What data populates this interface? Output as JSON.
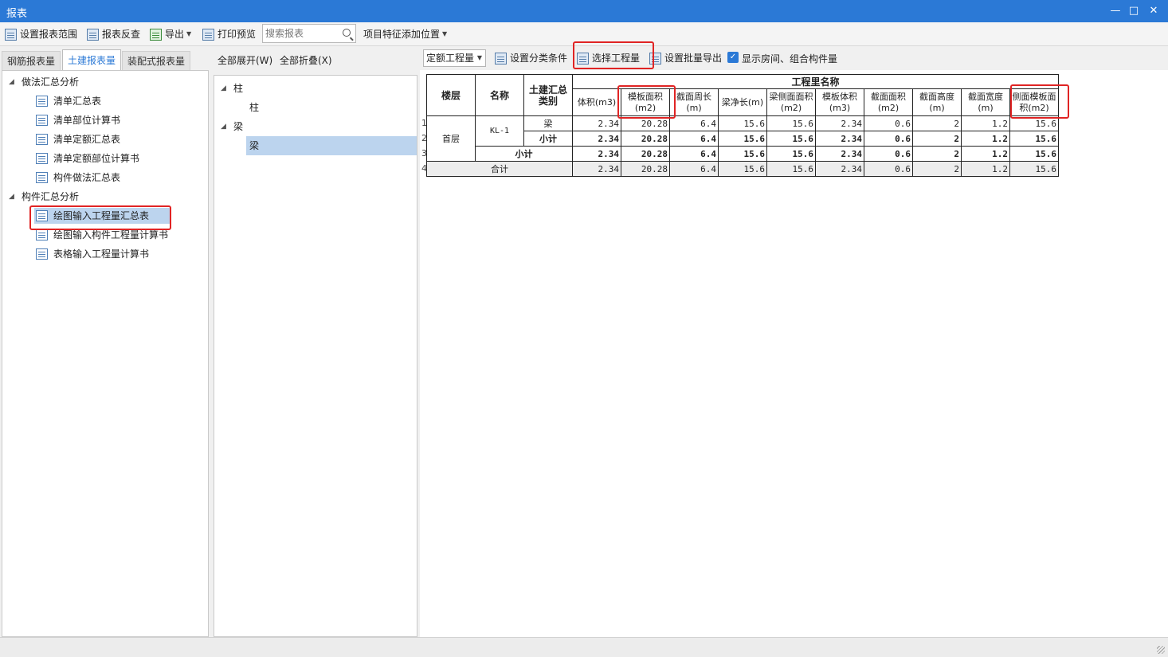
{
  "window": {
    "title": "报表",
    "minimize": "—",
    "maximize": "□",
    "close": "✕"
  },
  "toolbar": {
    "set_range": "设置报表范围",
    "reverse_check": "报表反查",
    "export": "导出",
    "print_preview": "打印预览",
    "search_placeholder": "搜索报表",
    "add_feature_position": "项目特征添加位置"
  },
  "tabs": [
    "钢筋报表量",
    "土建报表量",
    "装配式报表量"
  ],
  "left_tree": {
    "group1": "做法汇总分析",
    "group1_items": [
      "清单汇总表",
      "清单部位计算书",
      "清单定额汇总表",
      "清单定额部位计算书",
      "构件做法汇总表"
    ],
    "group2": "构件汇总分析",
    "group2_items": [
      "绘图输入工程量汇总表",
      "绘图输入构件工程量计算书",
      "表格输入工程量计算书"
    ]
  },
  "middle": {
    "expand_all": "全部展开(W)",
    "collapse_all": "全部折叠(X)",
    "tree": [
      {
        "label": "柱",
        "child": "柱"
      },
      {
        "label": "梁",
        "child": "梁"
      }
    ]
  },
  "right_toolbar": {
    "combo_value": "定额工程量",
    "set_category": "设置分类条件",
    "select_quantity": "选择工程量",
    "batch_export": "设置批量导出",
    "show_rooms": "显示房间、组合构件量"
  },
  "table": {
    "headers": {
      "floor": "楼层",
      "name": "名称",
      "category": "土建汇总类别",
      "quantity_group": "工程里名称"
    },
    "columns": [
      "体积(m3)",
      "模板面积(m2)",
      "截面周长(m)",
      "梁净长(m)",
      "梁侧面面积(m2)",
      "模板体积(m3)",
      "截面面积(m2)",
      "截面高度(m)",
      "截面宽度(m)",
      "侧面模板面积(m2)"
    ],
    "row_numbers": [
      "1",
      "2",
      "3",
      "4"
    ],
    "floor": "首层",
    "component": "KL-1",
    "rows": [
      {
        "category": "梁",
        "values": [
          "2.34",
          "20.28",
          "6.4",
          "15.6",
          "15.6",
          "2.34",
          "0.6",
          "2",
          "1.2",
          "15.6"
        ]
      },
      {
        "category": "小计",
        "values": [
          "2.34",
          "20.28",
          "6.4",
          "15.6",
          "15.6",
          "2.34",
          "0.6",
          "2",
          "1.2",
          "15.6"
        ]
      }
    ],
    "subtotal": {
      "label": "小计",
      "values": [
        "2.34",
        "20.28",
        "6.4",
        "15.6",
        "15.6",
        "2.34",
        "0.6",
        "2",
        "1.2",
        "15.6"
      ]
    },
    "total": {
      "label": "合计",
      "values": [
        "2.34",
        "20.28",
        "6.4",
        "15.6",
        "15.6",
        "2.34",
        "0.6",
        "2",
        "1.2",
        "15.6"
      ]
    }
  }
}
